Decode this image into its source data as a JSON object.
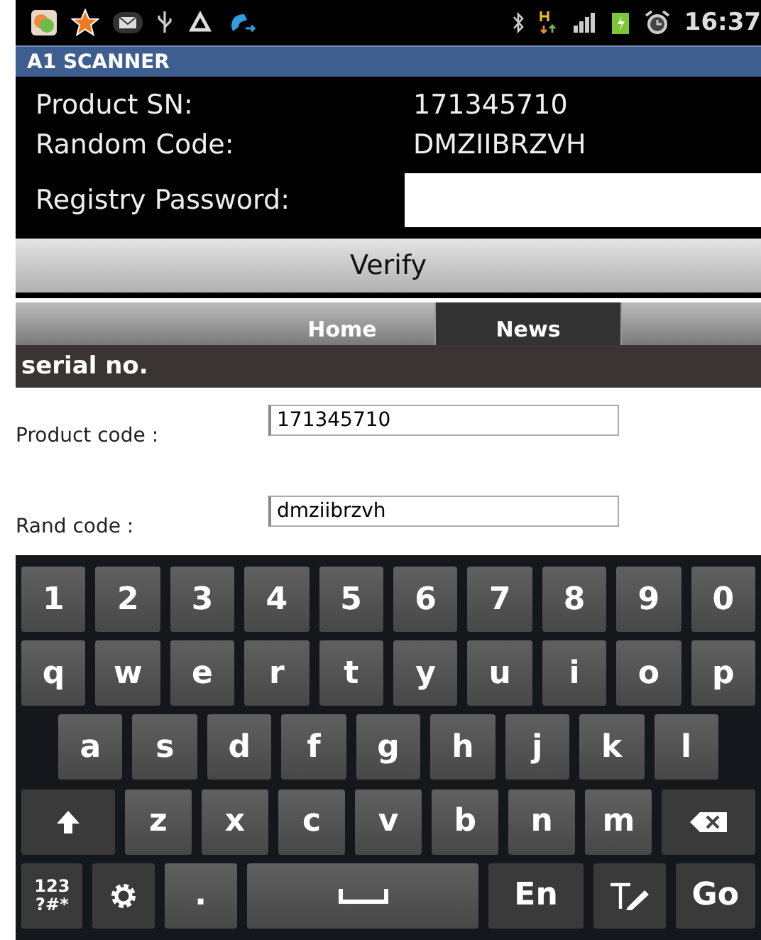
{
  "status_bar": {
    "time": "16:37"
  },
  "app_bar": {
    "title": "A1 SCANNER"
  },
  "info": [
    {
      "label": "Product SN:",
      "value": "171345710"
    },
    {
      "label": "Random Code:",
      "value": "DMZIIBRZVH"
    }
  ],
  "password": {
    "label": "Registry Password:"
  },
  "verify_button": "Verify",
  "web": {
    "tabs": [
      {
        "label": "Home",
        "selected": false
      },
      {
        "label": "News",
        "selected": true
      }
    ],
    "section_title": "serial no.",
    "fields": [
      {
        "label": "Product code :",
        "value": "171345710"
      },
      {
        "label": "Rand code :",
        "value": "dmziibrzvh"
      }
    ]
  },
  "keyboard": [
    [
      {
        "kind": "text",
        "label": "1"
      },
      {
        "kind": "text",
        "label": "2"
      },
      {
        "kind": "text",
        "label": "3"
      },
      {
        "kind": "text",
        "label": "4"
      },
      {
        "kind": "text",
        "label": "5"
      },
      {
        "kind": "text",
        "label": "6"
      },
      {
        "kind": "text",
        "label": "7"
      },
      {
        "kind": "text",
        "label": "8"
      },
      {
        "kind": "text",
        "label": "9"
      },
      {
        "kind": "text",
        "label": "0"
      }
    ],
    [
      {
        "kind": "text",
        "label": "q"
      },
      {
        "kind": "text",
        "label": "w"
      },
      {
        "kind": "text",
        "label": "e"
      },
      {
        "kind": "text",
        "label": "r"
      },
      {
        "kind": "text",
        "label": "t"
      },
      {
        "kind": "text",
        "label": "y"
      },
      {
        "kind": "text",
        "label": "u"
      },
      {
        "kind": "text",
        "label": "i"
      },
      {
        "kind": "text",
        "label": "o"
      },
      {
        "kind": "text",
        "label": "p"
      }
    ],
    [
      {
        "kind": "text",
        "label": "a"
      },
      {
        "kind": "text",
        "label": "s"
      },
      {
        "kind": "text",
        "label": "d"
      },
      {
        "kind": "text",
        "label": "f"
      },
      {
        "kind": "text",
        "label": "g"
      },
      {
        "kind": "text",
        "label": "h"
      },
      {
        "kind": "text",
        "label": "j"
      },
      {
        "kind": "text",
        "label": "k"
      },
      {
        "kind": "text",
        "label": "l"
      }
    ],
    [
      {
        "kind": "shift"
      },
      {
        "kind": "text",
        "label": "z"
      },
      {
        "kind": "text",
        "label": "x"
      },
      {
        "kind": "text",
        "label": "c"
      },
      {
        "kind": "text",
        "label": "v"
      },
      {
        "kind": "text",
        "label": "b"
      },
      {
        "kind": "text",
        "label": "n"
      },
      {
        "kind": "text",
        "label": "m"
      },
      {
        "kind": "backspace"
      }
    ],
    [
      {
        "kind": "symbols",
        "label": "123 ?#*"
      },
      {
        "kind": "settings"
      },
      {
        "kind": "text",
        "label": "."
      },
      {
        "kind": "space"
      },
      {
        "kind": "text",
        "label": "En"
      },
      {
        "kind": "handwriting"
      },
      {
        "kind": "text",
        "label": "Go"
      }
    ]
  ]
}
